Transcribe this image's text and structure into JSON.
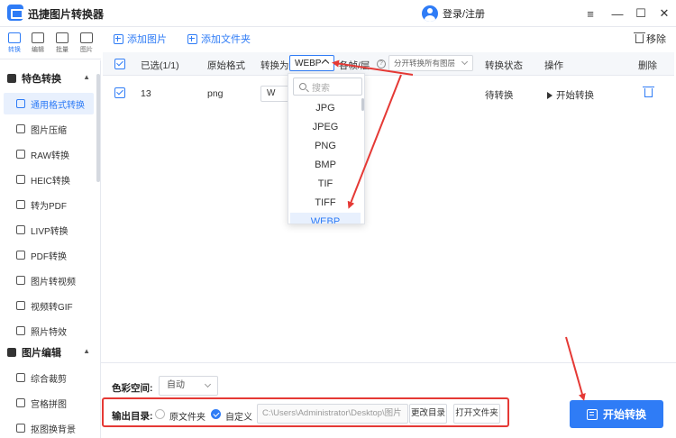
{
  "app": {
    "title": "迅捷图片转换器",
    "login": "登录/注册"
  },
  "window": {
    "minimize": "—",
    "restore": "☐",
    "close": "✕"
  },
  "rail": [
    {
      "label": "转换",
      "icon": "convert-icon",
      "active": true
    },
    {
      "label": "编辑",
      "icon": "edit-icon"
    },
    {
      "label": "批量",
      "icon": "batch-icon"
    },
    {
      "label": "图片",
      "icon": "image-icon"
    }
  ],
  "sidebar": {
    "section1": "特色转换",
    "items1": [
      "通用格式转换",
      "图片压缩",
      "RAW转换",
      "HEIC转换",
      "转为PDF",
      "LIVP转换",
      "PDF转换",
      "图片转视频",
      "视频转GIF",
      "照片特效"
    ],
    "section2": "图片编辑",
    "items2": [
      "综合裁剪",
      "宫格拼图",
      "抠图换背景"
    ]
  },
  "toolbar": {
    "add_image": "添加图片",
    "add_folder": "添加文件夹",
    "remove": "移除"
  },
  "table": {
    "headers": {
      "selected": "已选(1/1)",
      "orig_format": "原始格式",
      "convert_to": "转换为",
      "format_value": "WEBP",
      "frames": "各帧/层",
      "frames_option": "分开转换所有图层",
      "status": "转换状态",
      "action": "操作",
      "delete": "删除"
    },
    "rows": [
      {
        "name": "13",
        "format": "png",
        "target": "W",
        "status": "待转换",
        "action": "开始转换"
      }
    ]
  },
  "dropdown": {
    "search_placeholder": "搜索",
    "options": [
      "JPG",
      "JPEG",
      "PNG",
      "BMP",
      "TIF",
      "TIFF",
      "WEBP"
    ],
    "selected": "WEBP"
  },
  "bottom": {
    "color_space_label": "色彩空间:",
    "color_space_value": "自动",
    "output_label": "输出目录:",
    "radio_original": "原文件夹",
    "radio_custom": "自定义",
    "path": "C:\\Users\\Administrator\\Desktop\\图片",
    "change_dir": "更改目录",
    "open_folder": "打开文件夹",
    "start": "开始转换"
  },
  "colors": {
    "accent": "#2f7cf6",
    "annotation": "#e53935"
  }
}
